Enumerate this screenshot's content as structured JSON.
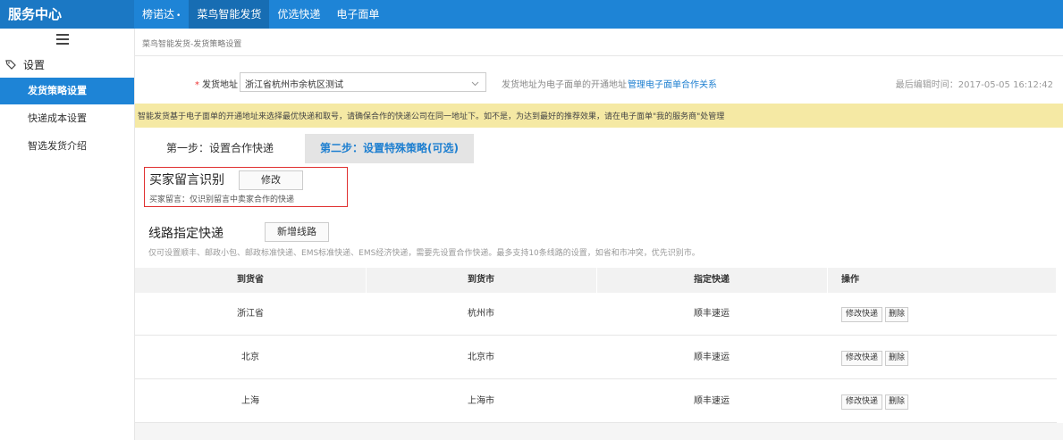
{
  "brand": "服务中心",
  "top_nav": [
    {
      "label": "榜诺达",
      "active": false,
      "dropdown": true
    },
    {
      "label": "菜鸟智能发货",
      "active": true
    },
    {
      "label": "优选快递",
      "active": false
    },
    {
      "label": "电子面单",
      "active": false
    }
  ],
  "sidebar": {
    "section_label": "设置",
    "items": [
      {
        "label": "发货策略设置",
        "active": true
      },
      {
        "label": "快递成本设置",
        "active": false
      },
      {
        "label": "智选发货介绍",
        "active": false
      }
    ]
  },
  "breadcrumb": "菜鸟智能发货-发货策略设置",
  "address": {
    "label": "发货地址",
    "required_mark": "*",
    "value": "浙江省杭州市余杭区测试",
    "hint": "发货地址为电子面单的开通地址",
    "link": "管理电子面单合作关系",
    "last_edit": "最后编辑时间：2017-05-05 16:12:42"
  },
  "notice": "智能发货基于电子面单的开通地址来选择最优快递和取号，请确保合作的快递公司在同一地址下。如不是，为达到最好的推荐效果，请在电子面单\"我的服务商\"处管理",
  "steps": [
    {
      "label": "第一步：设置合作快递",
      "active": false
    },
    {
      "label": "第二步：设置特殊策略(可选)",
      "active": true
    }
  ],
  "buyer": {
    "title": "买家留言识别",
    "modify_label": "修改",
    "desc": "买家留言：仅识别留言中卖家合作的快递"
  },
  "route": {
    "title": "线路指定快递",
    "add_label": "新增线路",
    "desc": "仅可设置顺丰、邮政小包、邮政标准快递、EMS标准快递、EMS经济快递，需要先设置合作快递。最多支持10条线路的设置，如省和市冲突，优先识别市。"
  },
  "table": {
    "headers": [
      "到货省",
      "到货市",
      "指定快递",
      "操作"
    ],
    "rows": [
      {
        "province": "浙江省",
        "city": "杭州市",
        "courier": "顺丰速运"
      },
      {
        "province": "北京",
        "city": "北京市",
        "courier": "顺丰速运"
      },
      {
        "province": "上海",
        "city": "上海市",
        "courier": "顺丰速运"
      }
    ],
    "edit_label": "修改快递",
    "delete_label": "删除"
  }
}
